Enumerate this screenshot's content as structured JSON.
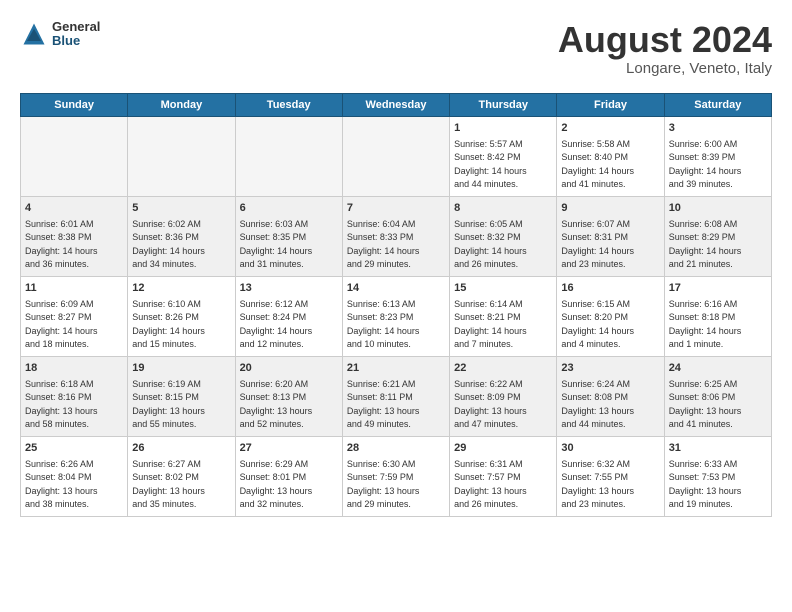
{
  "logo": {
    "general": "General",
    "blue": "Blue"
  },
  "title": "August 2024",
  "location": "Longare, Veneto, Italy",
  "days_of_week": [
    "Sunday",
    "Monday",
    "Tuesday",
    "Wednesday",
    "Thursday",
    "Friday",
    "Saturday"
  ],
  "weeks": [
    [
      {
        "day": "",
        "info": ""
      },
      {
        "day": "",
        "info": ""
      },
      {
        "day": "",
        "info": ""
      },
      {
        "day": "",
        "info": ""
      },
      {
        "day": "1",
        "info": "Sunrise: 5:57 AM\nSunset: 8:42 PM\nDaylight: 14 hours\nand 44 minutes."
      },
      {
        "day": "2",
        "info": "Sunrise: 5:58 AM\nSunset: 8:40 PM\nDaylight: 14 hours\nand 41 minutes."
      },
      {
        "day": "3",
        "info": "Sunrise: 6:00 AM\nSunset: 8:39 PM\nDaylight: 14 hours\nand 39 minutes."
      }
    ],
    [
      {
        "day": "4",
        "info": "Sunrise: 6:01 AM\nSunset: 8:38 PM\nDaylight: 14 hours\nand 36 minutes."
      },
      {
        "day": "5",
        "info": "Sunrise: 6:02 AM\nSunset: 8:36 PM\nDaylight: 14 hours\nand 34 minutes."
      },
      {
        "day": "6",
        "info": "Sunrise: 6:03 AM\nSunset: 8:35 PM\nDaylight: 14 hours\nand 31 minutes."
      },
      {
        "day": "7",
        "info": "Sunrise: 6:04 AM\nSunset: 8:33 PM\nDaylight: 14 hours\nand 29 minutes."
      },
      {
        "day": "8",
        "info": "Sunrise: 6:05 AM\nSunset: 8:32 PM\nDaylight: 14 hours\nand 26 minutes."
      },
      {
        "day": "9",
        "info": "Sunrise: 6:07 AM\nSunset: 8:31 PM\nDaylight: 14 hours\nand 23 minutes."
      },
      {
        "day": "10",
        "info": "Sunrise: 6:08 AM\nSunset: 8:29 PM\nDaylight: 14 hours\nand 21 minutes."
      }
    ],
    [
      {
        "day": "11",
        "info": "Sunrise: 6:09 AM\nSunset: 8:27 PM\nDaylight: 14 hours\nand 18 minutes."
      },
      {
        "day": "12",
        "info": "Sunrise: 6:10 AM\nSunset: 8:26 PM\nDaylight: 14 hours\nand 15 minutes."
      },
      {
        "day": "13",
        "info": "Sunrise: 6:12 AM\nSunset: 8:24 PM\nDaylight: 14 hours\nand 12 minutes."
      },
      {
        "day": "14",
        "info": "Sunrise: 6:13 AM\nSunset: 8:23 PM\nDaylight: 14 hours\nand 10 minutes."
      },
      {
        "day": "15",
        "info": "Sunrise: 6:14 AM\nSunset: 8:21 PM\nDaylight: 14 hours\nand 7 minutes."
      },
      {
        "day": "16",
        "info": "Sunrise: 6:15 AM\nSunset: 8:20 PM\nDaylight: 14 hours\nand 4 minutes."
      },
      {
        "day": "17",
        "info": "Sunrise: 6:16 AM\nSunset: 8:18 PM\nDaylight: 14 hours\nand 1 minute."
      }
    ],
    [
      {
        "day": "18",
        "info": "Sunrise: 6:18 AM\nSunset: 8:16 PM\nDaylight: 13 hours\nand 58 minutes."
      },
      {
        "day": "19",
        "info": "Sunrise: 6:19 AM\nSunset: 8:15 PM\nDaylight: 13 hours\nand 55 minutes."
      },
      {
        "day": "20",
        "info": "Sunrise: 6:20 AM\nSunset: 8:13 PM\nDaylight: 13 hours\nand 52 minutes."
      },
      {
        "day": "21",
        "info": "Sunrise: 6:21 AM\nSunset: 8:11 PM\nDaylight: 13 hours\nand 49 minutes."
      },
      {
        "day": "22",
        "info": "Sunrise: 6:22 AM\nSunset: 8:09 PM\nDaylight: 13 hours\nand 47 minutes."
      },
      {
        "day": "23",
        "info": "Sunrise: 6:24 AM\nSunset: 8:08 PM\nDaylight: 13 hours\nand 44 minutes."
      },
      {
        "day": "24",
        "info": "Sunrise: 6:25 AM\nSunset: 8:06 PM\nDaylight: 13 hours\nand 41 minutes."
      }
    ],
    [
      {
        "day": "25",
        "info": "Sunrise: 6:26 AM\nSunset: 8:04 PM\nDaylight: 13 hours\nand 38 minutes."
      },
      {
        "day": "26",
        "info": "Sunrise: 6:27 AM\nSunset: 8:02 PM\nDaylight: 13 hours\nand 35 minutes."
      },
      {
        "day": "27",
        "info": "Sunrise: 6:29 AM\nSunset: 8:01 PM\nDaylight: 13 hours\nand 32 minutes."
      },
      {
        "day": "28",
        "info": "Sunrise: 6:30 AM\nSunset: 7:59 PM\nDaylight: 13 hours\nand 29 minutes."
      },
      {
        "day": "29",
        "info": "Sunrise: 6:31 AM\nSunset: 7:57 PM\nDaylight: 13 hours\nand 26 minutes."
      },
      {
        "day": "30",
        "info": "Sunrise: 6:32 AM\nSunset: 7:55 PM\nDaylight: 13 hours\nand 23 minutes."
      },
      {
        "day": "31",
        "info": "Sunrise: 6:33 AM\nSunset: 7:53 PM\nDaylight: 13 hours\nand 19 minutes."
      }
    ]
  ]
}
